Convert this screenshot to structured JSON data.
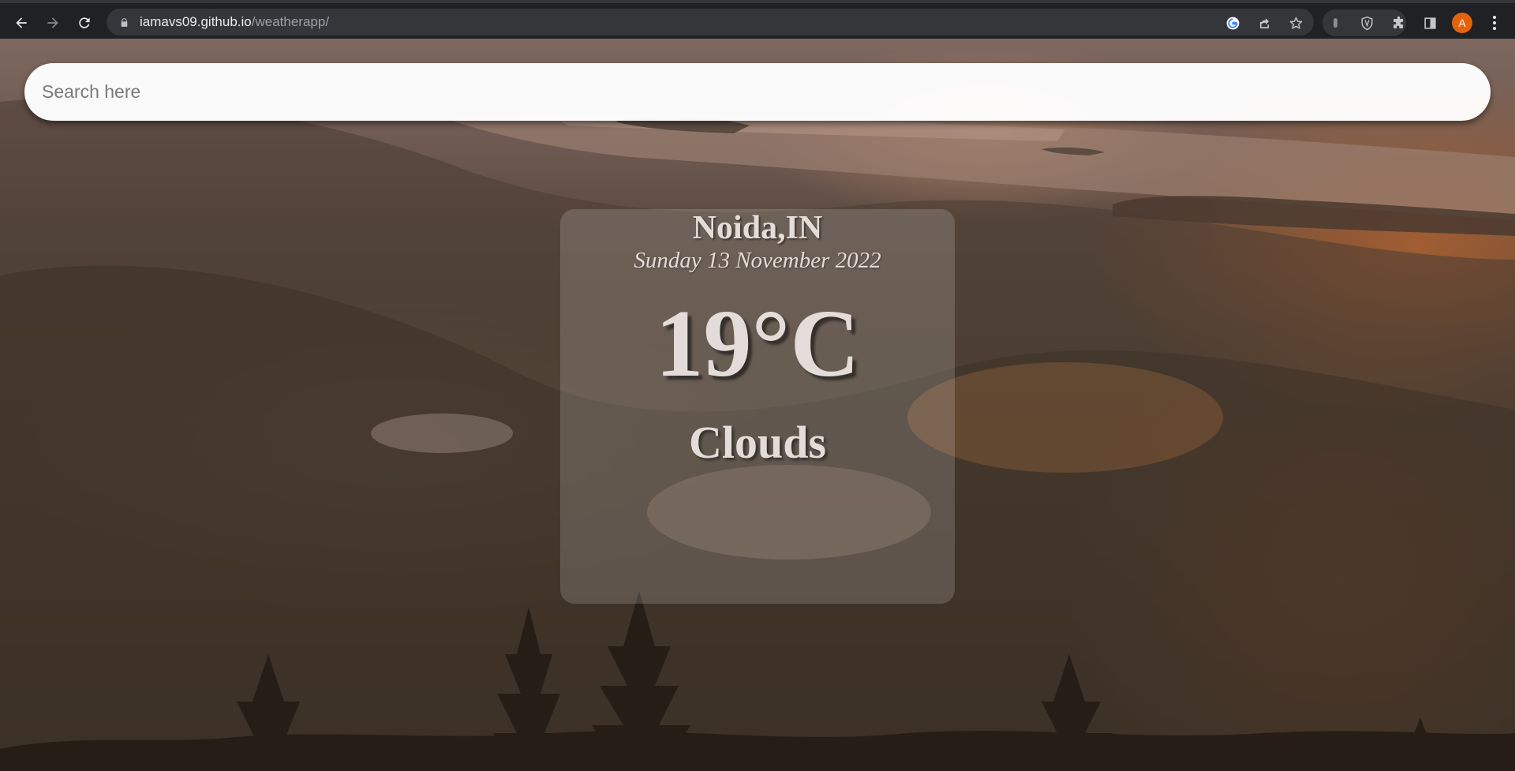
{
  "browser": {
    "url_host": "iamavs09.github.io",
    "url_path": "/weatherapp/",
    "avatar_letter": "A",
    "icons": {
      "back": "arrow-left-icon",
      "forward": "arrow-right-icon",
      "reload": "reload-icon",
      "lock": "lock-icon",
      "google": "google-icon",
      "share": "share-icon",
      "bookmark": "star-icon",
      "extension_1": "extension-icon",
      "extension_2": "shield-icon",
      "extensions": "puzzle-icon",
      "side_panel": "side-panel-icon",
      "menu": "kebab-menu-icon"
    }
  },
  "search": {
    "placeholder": "Search here",
    "value": ""
  },
  "weather": {
    "city": "Noida,IN",
    "date": "Sunday 13 November 2022",
    "temperature": "19°C",
    "condition": "Clouds"
  },
  "colors": {
    "chrome_bg": "#202124",
    "omnibox_bg": "#35363a",
    "avatar_bg": "#e2620e",
    "card_text": "#e4dcd8"
  }
}
